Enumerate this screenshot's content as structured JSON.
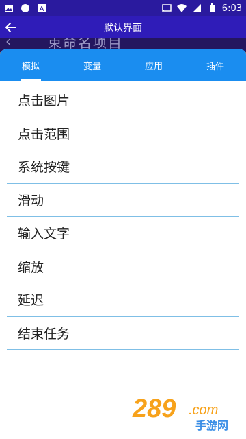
{
  "status_bar": {
    "time": "6:03",
    "icons": [
      "image-icon",
      "circle-icon",
      "a-icon",
      "cast-icon",
      "wifi-icon",
      "signal-icon",
      "battery-icon"
    ]
  },
  "app_bar": {
    "title": "默认界面",
    "back_icon": "arrow-left-icon"
  },
  "background_header": {
    "text": "束命名项目"
  },
  "sheet": {
    "tabs": [
      {
        "label": "模拟",
        "active": true
      },
      {
        "label": "变量",
        "active": false
      },
      {
        "label": "应用",
        "active": false
      },
      {
        "label": "插件",
        "active": false
      }
    ],
    "items": [
      {
        "label": "点击图片"
      },
      {
        "label": "点击范围"
      },
      {
        "label": "系统按键"
      },
      {
        "label": "滑动"
      },
      {
        "label": "输入文字"
      },
      {
        "label": "缩放"
      },
      {
        "label": "延迟"
      },
      {
        "label": "结束任务"
      }
    ]
  },
  "watermark": {
    "text_top": "289",
    "text_suffix": ".com",
    "text_bottom": "手游网"
  },
  "colors": {
    "status_bar": "#2a1a9e",
    "app_bar": "#2f1cb8",
    "tabs": "#1a8df0",
    "divider": "#7fbfe6",
    "watermark_orange": "#f7a21b",
    "watermark_blue": "#3a8ee6"
  }
}
